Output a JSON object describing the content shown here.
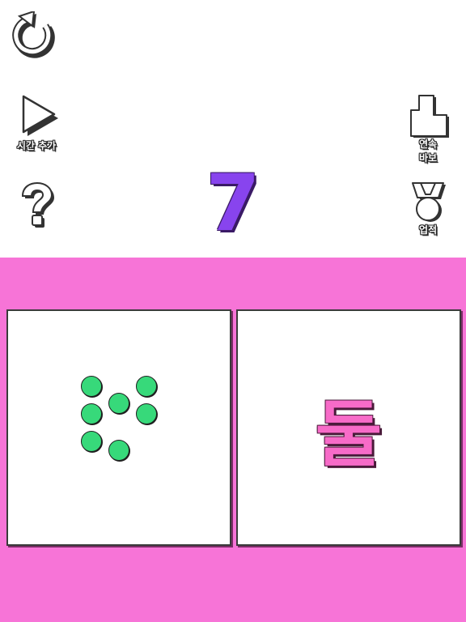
{
  "top_bar": {
    "restart_icon": "restart-icon",
    "play": {
      "icon": "play-icon",
      "label": "시간 추가"
    },
    "help_icon": "question-icon",
    "streak": {
      "icon": "podium-icon",
      "label_line1": "연속",
      "label_line2": "바보"
    },
    "achievement": {
      "icon": "medal-icon",
      "label": "업적"
    }
  },
  "score": {
    "value": "7"
  },
  "cards": {
    "left": {
      "type": "dots",
      "dot_count": 7,
      "dot_color": "#37d97a"
    },
    "right": {
      "type": "word",
      "word": "둘",
      "color": "#f76bc8"
    }
  },
  "colors": {
    "background_top": "#ffffff",
    "background_bottom": "#f774d7",
    "score_color": "#8844ee"
  }
}
